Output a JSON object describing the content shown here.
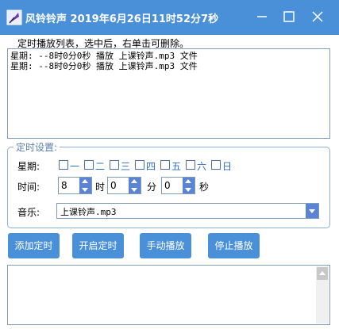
{
  "window": {
    "title": "风铃铃声  2019年6月26日11时52分7秒"
  },
  "list": {
    "header": "定时播放列表，选中后，右单击可删除。",
    "items": [
      "星期: --8时0分0秒 播放 上课铃声.mp3 文件",
      "星期: --8时0分0秒 播放 上课铃声.mp3 文件"
    ]
  },
  "settings": {
    "group_title": "定时设置:",
    "weekday_label": "星期:",
    "days": [
      "一",
      "二",
      "三",
      "四",
      "五",
      "六",
      "日"
    ],
    "time_label": "时间:",
    "hour_value": "8",
    "hour_unit": "时",
    "minute_value": "0",
    "minute_unit": "分",
    "second_value": "0",
    "second_unit": "秒",
    "music_label": "音乐:",
    "music_value": "上课铃声.mp3"
  },
  "buttons": {
    "add": "添加定时",
    "start": "开启定时",
    "manual_play": "手动播放",
    "stop": "停止播放"
  },
  "log": {
    "text": ""
  },
  "colors": {
    "title_bar": "#4a90d9",
    "button": "#4a90d9",
    "spin_button": "#5b84d6",
    "day_label": "#2b6fc0"
  }
}
